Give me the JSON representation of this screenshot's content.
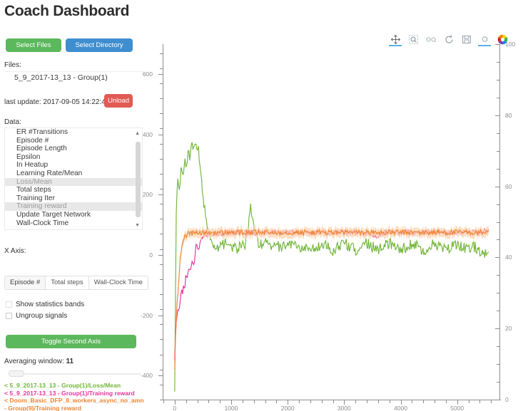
{
  "header": {
    "title": "Coach Dashboard"
  },
  "controls": {
    "select_files_label": "Select Files",
    "select_directory_label": "Select Directory",
    "files_label": "Files:",
    "files": [
      "5_9_2017-13_13 - Group(1)"
    ],
    "last_update_label": "last update: 2017-09-05 14:22:48",
    "unload_label": "Unload",
    "data_label": "Data:",
    "data_items": [
      {
        "label": "ER #Transitions",
        "selected": false
      },
      {
        "label": "Episode #",
        "selected": false
      },
      {
        "label": "Episode Length",
        "selected": false
      },
      {
        "label": "Epsilon",
        "selected": false
      },
      {
        "label": "In Heatup",
        "selected": false
      },
      {
        "label": "Learning Rate/Mean",
        "selected": false
      },
      {
        "label": "Loss/Mean",
        "selected": true
      },
      {
        "label": "Total steps",
        "selected": false
      },
      {
        "label": "Training Iter",
        "selected": false
      },
      {
        "label": "Training reward",
        "selected": true
      },
      {
        "label": "Update Target Network",
        "selected": false
      },
      {
        "label": "Wall-Clock Time",
        "selected": false
      }
    ],
    "xaxis_label": "X Axis:",
    "xaxis_options": [
      {
        "label": "Episode #",
        "active": true
      },
      {
        "label": "Total steps",
        "active": false
      },
      {
        "label": "Wall-Clock Time",
        "active": false
      }
    ],
    "show_statistics_bands_label": "Show statistics bands",
    "ungroup_signals_label": "Ungroup signals",
    "toggle_second_axis_label": "Toggle Second Axis",
    "averaging_window_label": "Averaging window:",
    "averaging_window_value": "11",
    "legend": [
      {
        "text": "< 5_9_2017-13_13 - Group(1)/Loss/Mean",
        "color": "#72b53a"
      },
      {
        "text": "< 5_9_2017-13_13 - Group(1)/Training reward",
        "color": "#e8339b"
      },
      {
        "text": "< Doom_Basic_DFP_8_workers_async_no_amn - Group(9)/Training reward",
        "color": "#ef8432"
      }
    ]
  },
  "chart_toolbar": {
    "tools": [
      {
        "name": "pan-icon",
        "label": "Pan",
        "active": true
      },
      {
        "name": "box-zoom-icon",
        "label": "Box Zoom",
        "active": false
      },
      {
        "name": "wheel-zoom-icon",
        "label": "Wheel Zoom",
        "active": false
      },
      {
        "name": "reset-icon",
        "label": "Reset",
        "active": false
      },
      {
        "name": "save-icon",
        "label": "Save",
        "active": false
      },
      {
        "name": "hover-icon",
        "label": "Hover",
        "active": true
      },
      {
        "name": "palette-icon",
        "label": "Bokeh",
        "active": false
      }
    ]
  },
  "chart_data": {
    "type": "line",
    "title": "",
    "xlabel": "",
    "ylabel": "",
    "grid": false,
    "legend_position": "external-left",
    "xlim": [
      -200,
      5750
    ],
    "x_ticks": [
      0,
      1000,
      2000,
      3000,
      4000,
      5000
    ],
    "y_left_label": "",
    "ylim": [
      -480,
      700
    ],
    "y_left_ticks": [
      -400,
      -200,
      0,
      200,
      400,
      600
    ],
    "y_right_label": "",
    "y_right_lim": [
      0,
      100
    ],
    "y_right_ticks": [
      0,
      20,
      40,
      60,
      80,
      100
    ],
    "series": [
      {
        "name": "5_9_2017-13_13 - Group(1)/Loss/Mean",
        "color": "#72b53a",
        "axis": "right",
        "x": [
          0,
          30,
          60,
          90,
          120,
          150,
          180,
          210,
          240,
          270,
          300,
          330,
          360,
          390,
          420,
          450,
          480,
          520,
          560,
          600,
          650,
          700,
          760,
          820,
          880,
          950,
          1000,
          1060,
          1120,
          1180,
          1240,
          1300,
          1340,
          1380,
          1420,
          1460,
          1500,
          1560,
          1620,
          1700,
          1780,
          1860,
          1940,
          2020,
          2100,
          2200,
          2300,
          2400,
          2500,
          2600,
          2700,
          2800,
          2900,
          3000,
          3100,
          3200,
          3300,
          3400,
          3500,
          3600,
          3700,
          3800,
          3900,
          4000,
          4100,
          4200,
          4300,
          4400,
          4500,
          4600,
          4700,
          4800,
          4900,
          5000,
          5100,
          5200,
          5300,
          5400,
          5500,
          5560
        ],
        "y": [
          2,
          58,
          62,
          60,
          66,
          64,
          68,
          66,
          70,
          68,
          72,
          70,
          73,
          71,
          70,
          66,
          60,
          55,
          50,
          47,
          45,
          43,
          42,
          43,
          44,
          43,
          42,
          43,
          42,
          44,
          43,
          48,
          54,
          50,
          47,
          45,
          44,
          43,
          44,
          43,
          44,
          43,
          44,
          43,
          44,
          43,
          42,
          43,
          42,
          44,
          43,
          42,
          43,
          44,
          43,
          42,
          43,
          44,
          43,
          42,
          43,
          44,
          43,
          42,
          43,
          44,
          43,
          42,
          43,
          44,
          43,
          42,
          43,
          44,
          43,
          42,
          43,
          42,
          41,
          40
        ]
      },
      {
        "name": "5_9_2017-13_13 - Group(1)/Training reward",
        "color": "#e8339b",
        "axis": "left",
        "x": [
          0,
          20,
          40,
          60,
          80,
          100,
          120,
          140,
          160,
          180,
          200,
          220,
          250,
          280,
          310,
          340,
          380,
          420,
          460,
          500,
          600,
          800,
          1000,
          1500,
          2000,
          2500,
          3000,
          3300,
          3600,
          3700,
          3800,
          3900,
          4000,
          4200,
          4400,
          4600,
          4800,
          5000,
          5200,
          5400,
          5560
        ],
        "y": [
          -350,
          -240,
          -210,
          -180,
          -175,
          -150,
          -120,
          -130,
          -95,
          -110,
          -60,
          -70,
          -40,
          -55,
          -20,
          -30,
          30,
          20,
          50,
          60,
          70,
          72,
          74,
          75,
          75,
          75,
          75,
          74,
          60,
          74,
          75,
          76,
          75,
          76,
          75,
          76,
          75,
          76,
          75,
          76,
          80
        ]
      },
      {
        "name": "Doom_Basic_DFP_8_workers_async_no_amn - Group(9)/Training reward",
        "color": "#ef8432",
        "axis": "left",
        "band_color": "#fbd4b0",
        "x": [
          0,
          20,
          40,
          60,
          80,
          100,
          120,
          140,
          160,
          200,
          240,
          280,
          320,
          360,
          400,
          500,
          700,
          1000,
          1400,
          1800,
          2200,
          2600,
          3000,
          3400,
          3800,
          4200,
          4600,
          5000,
          5400,
          5560
        ],
        "y": [
          -380,
          -240,
          -170,
          -120,
          -60,
          -10,
          20,
          45,
          58,
          66,
          70,
          72,
          73,
          73,
          74,
          74,
          74,
          75,
          75,
          75,
          75,
          75,
          75,
          75,
          75,
          75,
          75,
          75,
          75,
          76
        ]
      }
    ]
  }
}
